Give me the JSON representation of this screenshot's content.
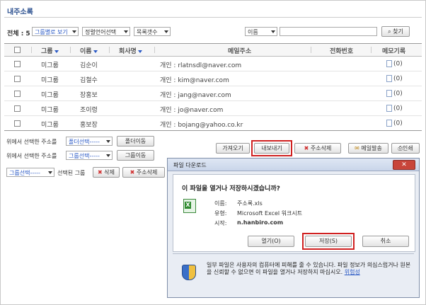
{
  "page": {
    "title": "내주소록"
  },
  "toolbar": {
    "total_label": "전체 : 5",
    "group_view": "그룹별로 보기",
    "sort_lang": "정렬언어선택",
    "list_count": "목록갯수",
    "search_field": "이름",
    "search_value": "",
    "search_button": "찾기"
  },
  "table": {
    "headers": {
      "group": "그룹",
      "name": "이름",
      "company": "회사명",
      "email": "메일주소",
      "phone": "전화번호",
      "memo": "메모기록"
    },
    "rows": [
      {
        "group": "미그룹",
        "name": "김순이",
        "email": "개인 : rlatnsdl@naver.com",
        "memo": "(0)"
      },
      {
        "group": "미그룹",
        "name": "김철수",
        "email": "개인 : kim@naver.com",
        "memo": "(0)"
      },
      {
        "group": "미그룹",
        "name": "장홍보",
        "email": "개인 : jang@naver.com",
        "memo": "(0)"
      },
      {
        "group": "미그룹",
        "name": "조이령",
        "email": "개인 : jo@naver.com",
        "memo": "(0)"
      },
      {
        "group": "미그룹",
        "name": "홍보장",
        "email": "개인 : bojang@yahoo.co.kr",
        "memo": "(0)"
      }
    ]
  },
  "actions": {
    "row1_label": "위에서 선택한 주소를",
    "folder_select": "폴더선택-----",
    "folder_move": "폴더이동",
    "row2_label": "위에서 선택한 주소를",
    "group_select": "그룹선택-----",
    "group_move": "그룹이동",
    "row3_select": "그룹선택-----",
    "row3_label": "선택된 그룹",
    "delete": "삭제",
    "delete_address": "주소삭제",
    "import": "가져오기",
    "export": "내보내기",
    "address_delete": "주소삭제",
    "send_mail": "메일발송",
    "print": "인쇄"
  },
  "dialog": {
    "title": "파일 다운로드",
    "question": "이 파일을 열거나 저장하시겠습니까?",
    "name_label": "이름:",
    "name_value": "주소록.xls",
    "type_label": "유형:",
    "type_value": "Microsoft Excel 워크시트",
    "from_label": "시작:",
    "from_value": "n.hanbiro.com",
    "open_button": "열기(O)",
    "save_button": "저장(S)",
    "cancel_button": "취소",
    "warning_text": "일부 파일은 사용자의 컴퓨터에 피해를 줄 수 있습니다. 파일 정보가 의심스럽거나 원본을 신뢰할 수 없으면 이 파일을 열거나 저장하지 마십시오.",
    "warning_link": "위험성"
  }
}
